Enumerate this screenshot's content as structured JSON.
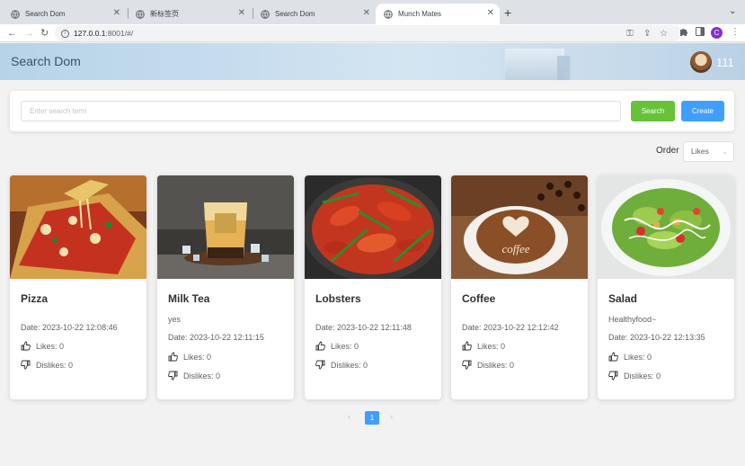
{
  "browser": {
    "tabs": [
      {
        "title": "Search Dom",
        "active": false
      },
      {
        "title": "新标签页",
        "active": false
      },
      {
        "title": "Search Dom",
        "active": false
      },
      {
        "title": "Munch Mates",
        "active": true
      }
    ],
    "new_tab": "+",
    "tab_menu": "⌄",
    "url_host": "127.0.0.1",
    "url_rest": ":8001/#/",
    "profile_initial": "C"
  },
  "header": {
    "title": "Search Dom",
    "username": "111"
  },
  "search": {
    "placeholder": "Enter search term",
    "search_label": "Search",
    "create_label": "Create"
  },
  "order": {
    "label": "Order",
    "selected": "Likes"
  },
  "cards": [
    {
      "title": "Pizza",
      "description": "",
      "date": "Date: 2023-10-22 12:08:46",
      "likes": "Likes: 0",
      "dislikes": "Dislikes: 0",
      "image": "pizza"
    },
    {
      "title": "Milk Tea",
      "description": "yes",
      "date": "Date: 2023-10-22 12:11:15",
      "likes": "Likes: 0",
      "dislikes": "Dislikes: 0",
      "image": "milk-tea"
    },
    {
      "title": "Lobsters",
      "description": "",
      "date": "Date: 2023-10-22 12:11:48",
      "likes": "Likes: 0",
      "dislikes": "Dislikes: 0",
      "image": "lobsters"
    },
    {
      "title": "Coffee",
      "description": "",
      "date": "Date: 2023-10-22 12:12:42",
      "likes": "Likes: 0",
      "dislikes": "Dislikes: 0",
      "image": "coffee"
    },
    {
      "title": "Salad",
      "description": "Healthyfood~",
      "date": "Date: 2023-10-22 12:13:35",
      "likes": "Likes: 0",
      "dislikes": "Dislikes: 0",
      "image": "salad"
    }
  ],
  "pagination": {
    "current_page": "1",
    "prev": "‹",
    "next": "›"
  },
  "colors": {
    "accent_blue": "#409eff",
    "search_green": "#67c23a"
  }
}
